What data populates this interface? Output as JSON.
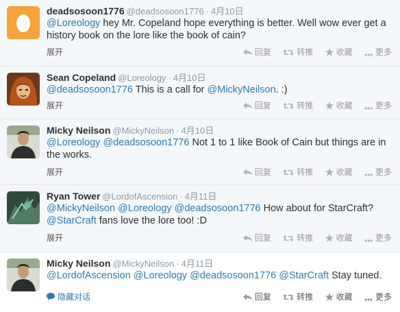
{
  "ui": {
    "expand_label": "展开",
    "hide_conversation_label": "隐藏对话",
    "actions": {
      "reply": "回复",
      "retweet": "转推",
      "favorite": "收藏",
      "more": "更多"
    }
  },
  "tweets": [
    {
      "name": "deadsosoon1776",
      "handle": "@deadsosoon1776",
      "date": "4月10日",
      "parts": [
        {
          "t": "@Loreology",
          "m": true
        },
        {
          "t": " hey Mr. Copeland hope everything is better. Well wow ever get a history book on the lore like the book of cain?",
          "m": false
        }
      ]
    },
    {
      "name": "Sean Copeland",
      "handle": "@Loreology",
      "date": "4月10日",
      "parts": [
        {
          "t": "@deadsosoon1776",
          "m": true
        },
        {
          "t": " This is a call for ",
          "m": false
        },
        {
          "t": "@MickyNeilson",
          "m": true
        },
        {
          "t": ". :)",
          "m": false
        }
      ]
    },
    {
      "name": "Micky Neilson",
      "handle": "@MickyNeilson",
      "date": "4月10日",
      "parts": [
        {
          "t": "@Loreology",
          "m": true
        },
        {
          "t": " ",
          "m": false
        },
        {
          "t": "@deadsosoon1776",
          "m": true
        },
        {
          "t": " Not 1 to 1 like Book of Cain but things are in the works.",
          "m": false
        }
      ]
    },
    {
      "name": "Ryan Tower",
      "handle": "@LordofAscension",
      "date": "4月11日",
      "parts": [
        {
          "t": "@MickyNeilson",
          "m": true
        },
        {
          "t": " ",
          "m": false
        },
        {
          "t": "@Loreology",
          "m": true
        },
        {
          "t": " ",
          "m": false
        },
        {
          "t": "@deadsosoon1776",
          "m": true
        },
        {
          "t": " How about for StarCraft? ",
          "m": false
        },
        {
          "t": "@StarCraft",
          "m": true
        },
        {
          "t": " fans love the lore too! :D",
          "m": false
        }
      ]
    },
    {
      "name": "Micky Neilson",
      "handle": "@MickyNeilson",
      "date": "4月11日",
      "parts": [
        {
          "t": "@LordofAscension",
          "m": true
        },
        {
          "t": " ",
          "m": false
        },
        {
          "t": "@Loreology",
          "m": true
        },
        {
          "t": " ",
          "m": false
        },
        {
          "t": "@deadsosoon1776",
          "m": true
        },
        {
          "t": " ",
          "m": false
        },
        {
          "t": "@StarCraft",
          "m": true
        },
        {
          "t": " Stay tuned.",
          "m": false
        }
      ]
    }
  ],
  "colors": {
    "link": "#2b7bb9",
    "muted": "#8899a6",
    "text": "#292f33"
  }
}
